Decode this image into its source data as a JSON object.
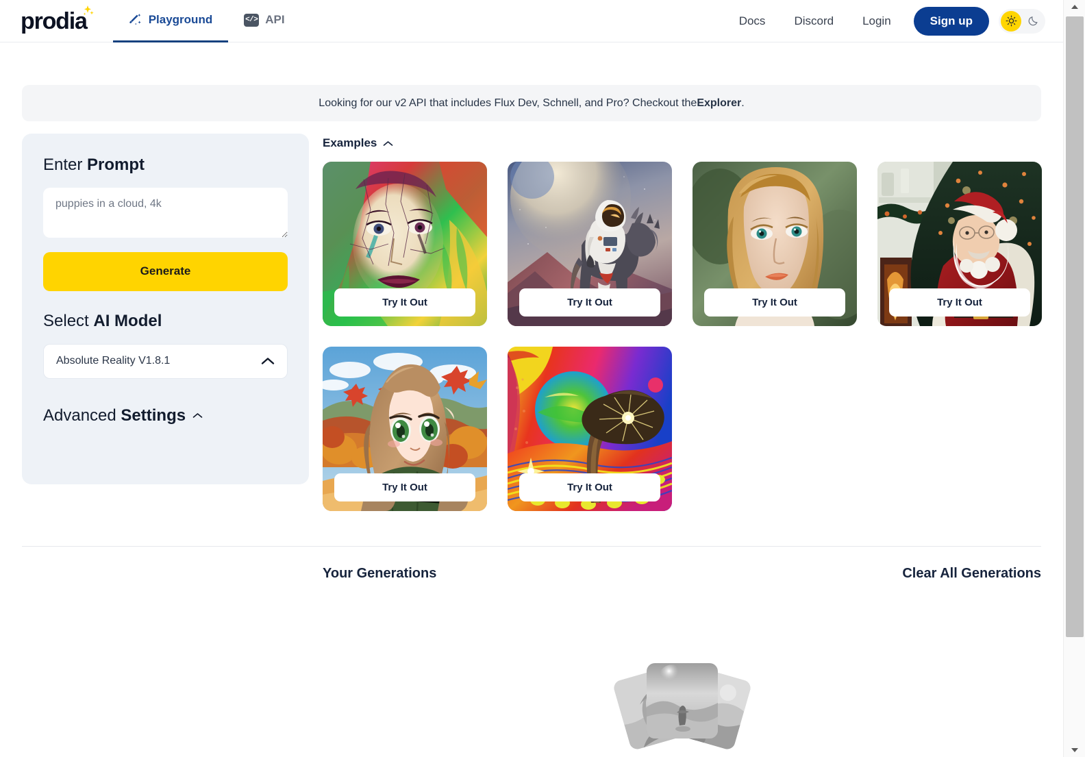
{
  "brand": {
    "name": "prodia"
  },
  "nav": {
    "tabs": [
      {
        "label": "Playground",
        "icon": "magic-wand-icon",
        "active": true
      },
      {
        "label": "API",
        "icon": "code-brackets-icon",
        "active": false
      }
    ],
    "links": [
      {
        "label": "Docs"
      },
      {
        "label": "Discord"
      },
      {
        "label": "Login"
      }
    ],
    "signup_label": "Sign up",
    "theme": {
      "light_icon": "sun-icon",
      "dark_icon": "moon-icon",
      "active": "light"
    }
  },
  "banner": {
    "text_before": "Looking for our v2 API that includes Flux Dev, Schnell, and Pro? Checkout the ",
    "link_label": "Explorer",
    "text_after": "."
  },
  "sidebar": {
    "prompt_title_light": "Enter ",
    "prompt_title_bold": "Prompt",
    "prompt_placeholder": "puppies in a cloud, 4k",
    "prompt_value": "",
    "generate_label": "Generate",
    "model_title_light": "Select ",
    "model_title_bold": "AI Model",
    "model_selected": "Absolute Reality V1.8.1",
    "model_chevron": "chevron-up-icon",
    "advanced_title_light": "Advanced ",
    "advanced_title_bold": "Settings",
    "advanced_chevron": "chevron-up-icon"
  },
  "examples": {
    "heading": "Examples",
    "chevron": "chevron-up-icon",
    "try_label": "Try It Out",
    "cards": [
      {
        "alt": "colorful-abstract-portrait",
        "try_label": "Try It Out"
      },
      {
        "alt": "astronaut-riding-horse-alien-planet",
        "try_label": "Try It Out"
      },
      {
        "alt": "photorealistic-blonde-woman-portrait",
        "try_label": "Try It Out"
      },
      {
        "alt": "santa-claus-christmas-tree",
        "try_label": "Try It Out"
      },
      {
        "alt": "anime-girl-autumn-scarf",
        "try_label": "Try It Out"
      },
      {
        "alt": "psychedelic-tree-landscape",
        "try_label": "Try It Out"
      }
    ]
  },
  "generations": {
    "title": "Your Generations",
    "clear_label": "Clear All Generations",
    "empty_illustration": "fanned-image-cards-placeholder"
  },
  "colors": {
    "accent_yellow": "#ffd400",
    "brand_navy": "#0b3d91",
    "sidebar_bg": "#eef2f7",
    "banner_bg": "#f4f5f7",
    "text_dark": "#16233c"
  },
  "scrollbar": {
    "up_icon": "scroll-up-arrow-icon",
    "down_icon": "scroll-down-arrow-icon"
  }
}
